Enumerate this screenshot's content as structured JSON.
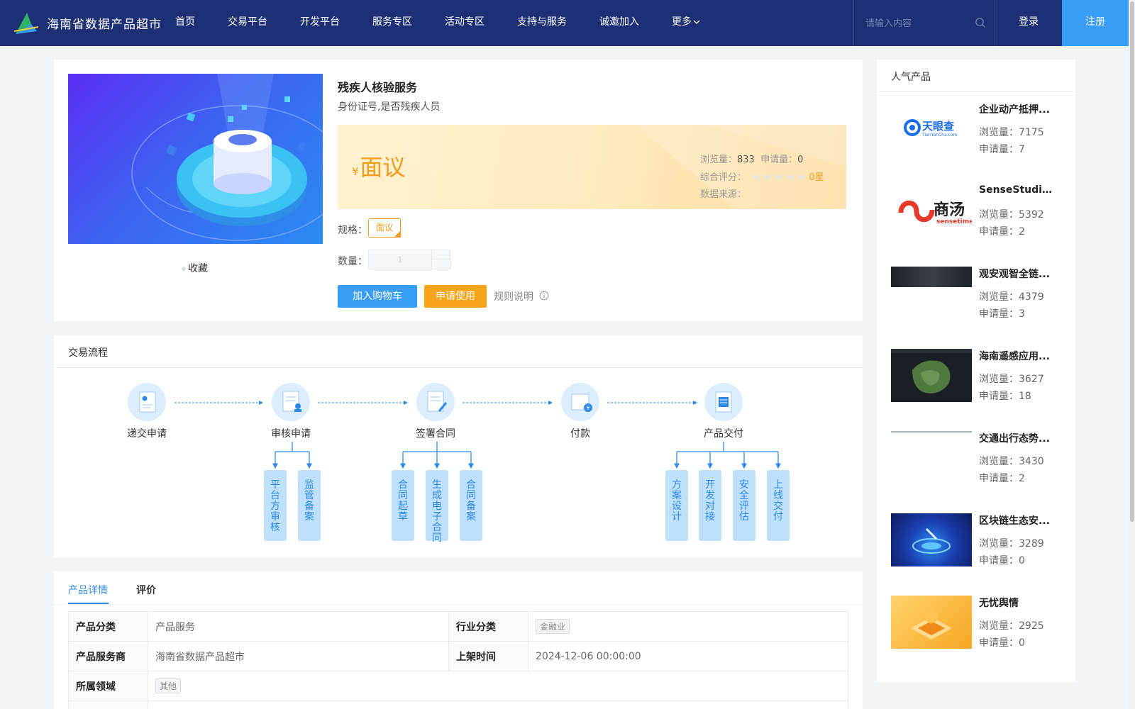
{
  "header": {
    "site_title": "海南省数据产品超市",
    "nav": [
      "首页",
      "交易平台",
      "开发平台",
      "服务专区",
      "活动专区",
      "支持与服务",
      "诚邀加入",
      "更多"
    ],
    "search_placeholder": "请输入内容",
    "login": "登录",
    "register": "注册",
    "colors": {
      "bar": "#1d3075",
      "register": "#3a9df5"
    }
  },
  "product": {
    "title": "残疾人核验服务",
    "subtitle": "身份证号,是否残疾人员",
    "currency": "¥",
    "price": "面议",
    "views_label": "浏览量：",
    "views": "833",
    "applies_label": "申请量：",
    "applies": "0",
    "rating_label": "综合评分：",
    "rating_stars": 0,
    "rating_text": "0星",
    "source_label": "数据来源：",
    "spec_label": "规格：",
    "spec_value": "面议",
    "qty_label": "数量：",
    "qty_value": "1",
    "favorite": "收藏",
    "add_cart": "加入购物车",
    "apply": "申请使用",
    "rules": "规则说明"
  },
  "process": {
    "title": "交易流程",
    "steps": [
      "递交申请",
      "审核申请",
      "签署合同",
      "付款",
      "产品交付"
    ],
    "sub": {
      "review": [
        "平台方审核",
        "监管备案"
      ],
      "contract": [
        "合同起草",
        "生成电子合同",
        "合同备案"
      ],
      "delivery": [
        "方案设计",
        "开发对接",
        "安全评估",
        "上线交付"
      ]
    }
  },
  "detail": {
    "tabs": [
      "产品详情",
      "评价"
    ],
    "rows": {
      "category_label": "产品分类",
      "category": "产品服务",
      "industry_label": "行业分类",
      "industry": "金融业",
      "provider_label": "产品服务商",
      "provider": "海南省数据产品超市",
      "listed_label": "上架时间",
      "listed": "2024-12-06 00:00:00",
      "domain_label": "所属领域",
      "domain": "其他"
    }
  },
  "sidebar": {
    "title": "人气产品",
    "views_label": "浏览量：",
    "applies_label": "申请量：",
    "items": [
      {
        "name": "企业动产抵押...",
        "views": "7175",
        "applies": "7",
        "logo_text": "天眼查",
        "logo_sub": "TianYanCha.com"
      },
      {
        "name": "SenseStudio...",
        "views": "5392",
        "applies": "2",
        "logo_text": "商汤",
        "logo_sub": "sensetime"
      },
      {
        "name": "观安观智全链...",
        "views": "4379",
        "applies": "3"
      },
      {
        "name": "海南遥感应用...",
        "views": "3627",
        "applies": "18"
      },
      {
        "name": "交通出行态势...",
        "views": "3430",
        "applies": "2"
      },
      {
        "name": "区块链生态安...",
        "views": "3289",
        "applies": "0"
      },
      {
        "name": "无忧舆情",
        "views": "2925",
        "applies": "0"
      }
    ]
  }
}
